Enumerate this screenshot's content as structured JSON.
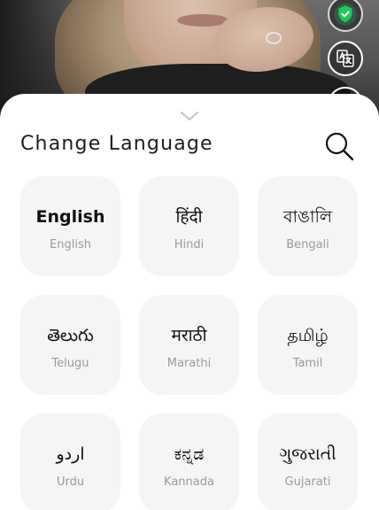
{
  "sheet": {
    "title": "Change Language"
  },
  "icons": {
    "shield": "shield-check-icon",
    "translate": "translate-icon",
    "collapse": "chevron-down-icon",
    "search": "search-icon"
  },
  "colors": {
    "accent": "#22c55e",
    "card_bg": "#f5f5f5",
    "muted_text": "#9a9a9a"
  },
  "languages": [
    {
      "native": "English",
      "english": "English"
    },
    {
      "native": "हिंदी",
      "english": "Hindi"
    },
    {
      "native": "বাঙালি",
      "english": "Bengali"
    },
    {
      "native": "తెలుగు",
      "english": "Telugu"
    },
    {
      "native": "मराठी",
      "english": "Marathi"
    },
    {
      "native": "தமிழ்",
      "english": "Tamil"
    },
    {
      "native": "اردو",
      "english": "Urdu"
    },
    {
      "native": "ಕನ್ನಡ",
      "english": "Kannada"
    },
    {
      "native": "ગુજરાતી",
      "english": "Gujarati"
    }
  ]
}
